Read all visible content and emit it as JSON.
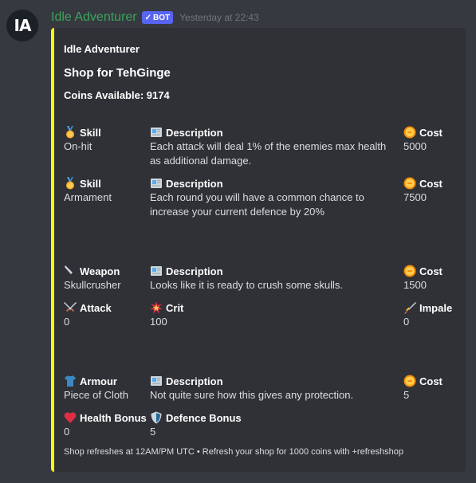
{
  "message": {
    "avatar_text": "IA",
    "author": "Idle Adventurer",
    "bot_tag": "BOT",
    "bot_check": "✓",
    "timestamp": "Yesterday at 22:43"
  },
  "embed": {
    "accent_color": "#fbf70d",
    "author": "Idle Adventurer",
    "title": "Shop for TehGinge",
    "coins": "Coins Available: 9174",
    "footer": "Shop refreshes at 12AM/PM UTC  •  Refresh your shop for 1000 coins with +refreshshop",
    "sections": [
      {
        "row1": [
          {
            "icon": "medal-icon",
            "name": "Skill",
            "value": "On-hit"
          },
          {
            "icon": "newspaper-icon",
            "name": "Description",
            "value": "Each attack will deal 1% of the enemies max health as additional damage."
          },
          {
            "icon": "coin-icon",
            "name": "Cost",
            "value": "5000"
          }
        ]
      },
      {
        "row1": [
          {
            "icon": "medal-icon",
            "name": "Skill",
            "value": "Armament"
          },
          {
            "icon": "newspaper-icon",
            "name": "Description",
            "value": "Each round you will have a common chance to increase your current defence by 20%"
          },
          {
            "icon": "coin-icon",
            "name": "Cost",
            "value": "7500"
          }
        ]
      },
      {
        "row1": [
          {
            "icon": "knife-icon",
            "name": "Weapon",
            "value": "Skullcrusher"
          },
          {
            "icon": "newspaper-icon",
            "name": "Description",
            "value": "Looks like it is ready to crush some skulls."
          },
          {
            "icon": "coin-icon",
            "name": "Cost",
            "value": "1500"
          }
        ],
        "row2": [
          {
            "icon": "crossed-swords-icon",
            "name": "Attack",
            "value": "0"
          },
          {
            "icon": "collision-icon",
            "name": "Crit",
            "value": "100"
          },
          {
            "icon": "dagger-icon",
            "name": "Impale",
            "value": "0"
          }
        ]
      },
      {
        "row1": [
          {
            "icon": "shirt-icon",
            "name": "Armour",
            "value": "Piece of Cloth"
          },
          {
            "icon": "newspaper-icon",
            "name": "Description",
            "value": "Not quite sure how this gives any protection."
          },
          {
            "icon": "coin-icon",
            "name": "Cost",
            "value": "5"
          }
        ],
        "row2": [
          {
            "icon": "heart-icon",
            "name": "Health Bonus",
            "value": "0"
          },
          {
            "icon": "shield-icon",
            "name": "Defence Bonus",
            "value": "5"
          }
        ]
      }
    ]
  }
}
